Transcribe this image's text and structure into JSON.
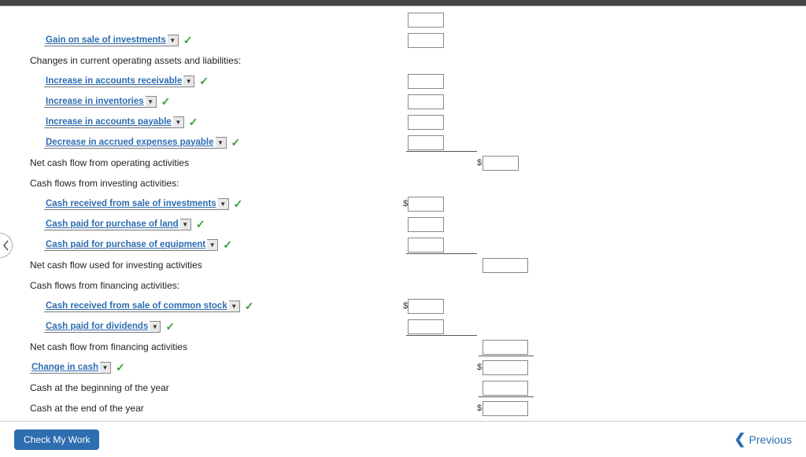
{
  "rows": {
    "gain_sale_investments": "Gain on sale of investments",
    "changes_heading": "Changes in current operating assets and liabilities:",
    "incr_ar": "Increase in accounts receivable",
    "incr_inv": "Increase in inventories",
    "incr_ap": "Increase in accounts payable",
    "decr_accrued": "Decrease in accrued expenses payable",
    "net_cash_op": "Net cash flow from operating activities",
    "cf_investing_heading": "Cash flows from investing activities:",
    "cash_sale_invest": "Cash received from sale of investments",
    "cash_paid_land": "Cash paid for purchase of land",
    "cash_paid_equip": "Cash paid for purchase of equipment",
    "net_cash_invest": "Net cash flow used for investing activities",
    "cf_financing_heading": "Cash flows from financing activities:",
    "cash_common_stock": "Cash received from sale of common stock",
    "cash_dividends": "Cash paid for dividends",
    "net_cash_fin": "Net cash flow from financing activities",
    "change_in_cash": "Change in cash",
    "cash_begin": "Cash at the beginning of the year",
    "cash_end": "Cash at the end of the year"
  },
  "symbols": {
    "dollar": "$",
    "check": "✓",
    "dd_arrow": "▼"
  },
  "footer": {
    "check_work": "Check My Work",
    "previous": "Previous"
  }
}
